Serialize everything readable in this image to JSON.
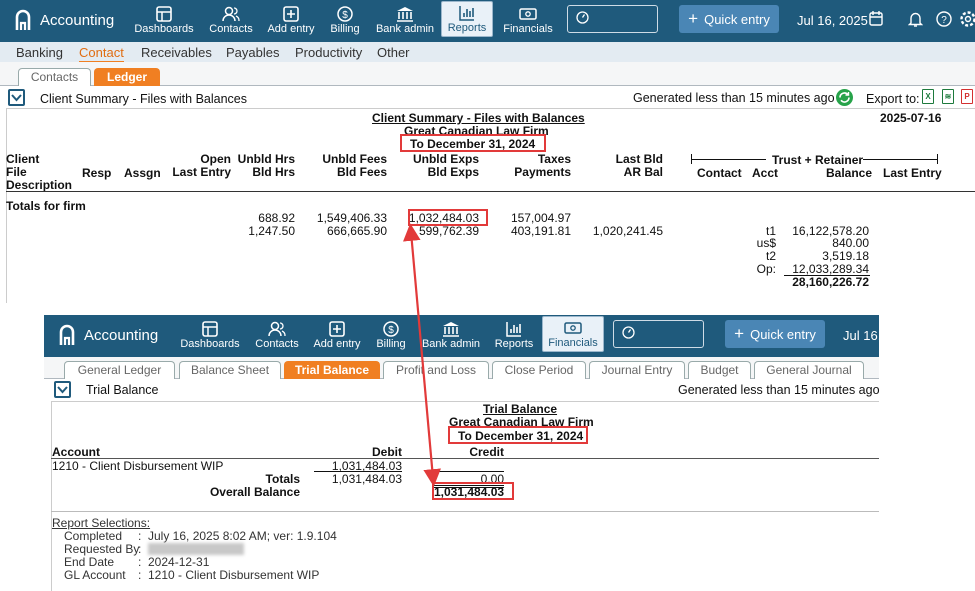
{
  "top": {
    "brand": "Accounting",
    "nav": [
      "Dashboards",
      "Contacts",
      "Add entry",
      "Billing",
      "Bank admin",
      "Reports",
      "Financials"
    ],
    "quick_entry": "Quick entry",
    "date": "Jul 16, 2025",
    "subnav": [
      "Banking",
      "Contact",
      "Receivables",
      "Payables",
      "Productivity",
      "Other"
    ],
    "tabs": [
      "Contacts",
      "Ledger"
    ],
    "panel_title": "Client Summary - Files with Balances",
    "generated": "Generated less than 15 minutes ago",
    "export_label": "Export to:",
    "report": {
      "title": "Client Summary - Files with Balances",
      "firm": "Great Canadian Law Firm",
      "period": "To December 31, 2024",
      "date": "2025-07-16",
      "headers": {
        "client": "Client",
        "file": "File",
        "description": "Description",
        "resp": "Resp",
        "assgn": "Assgn",
        "open": "Open",
        "last_entry": "Last Entry",
        "unbld_hrs": "Unbld Hrs",
        "bld_hrs": "Bld Hrs",
        "unbld_fees": "Unbld Fees",
        "bld_fees": "Bld Fees",
        "unbld_exps": "Unbld Exps",
        "bld_exps": "Bld Exps",
        "taxes": "Taxes",
        "payments": "Payments",
        "last_bld": "Last Bld",
        "ar_bal": "AR Bal",
        "trust_retainer": "Trust + Retainer",
        "contact": "Contact",
        "acct": "Acct",
        "balance": "Balance",
        "last_entry2": "Last Entry"
      },
      "totals_label": "Totals for firm",
      "row1": {
        "hrs": "688.92",
        "fees": "1,549,406.33",
        "exps": "1,032,484.03",
        "taxes": "157,004.97"
      },
      "row2": {
        "hrs": "1,247.50",
        "fees": "666,665.90",
        "exps": "599,762.39",
        "payments": "403,191.81",
        "ar": "1,020,241.45"
      },
      "trust": [
        {
          "acct": "t1",
          "bal": "16,122,578.20"
        },
        {
          "acct": "us$",
          "bal": "840.00"
        },
        {
          "acct": "t2",
          "bal": "3,519.18"
        },
        {
          "acct": "Op:",
          "bal": "12,033,289.34"
        }
      ],
      "trust_total": "28,160,226.72"
    }
  },
  "bottom": {
    "brand": "Accounting",
    "nav": [
      "Dashboards",
      "Contacts",
      "Add entry",
      "Billing",
      "Bank admin",
      "Reports",
      "Financials"
    ],
    "quick_entry": "Quick entry",
    "date": "Jul 16,",
    "tabs": [
      "General Ledger",
      "Balance Sheet",
      "Trial Balance",
      "Profit and Loss",
      "Close Period",
      "Journal Entry",
      "Budget",
      "General Journal"
    ],
    "panel_title": "Trial Balance",
    "generated": "Generated less than 15 minutes ago",
    "report": {
      "title": "Trial Balance",
      "firm": "Great Canadian Law Firm",
      "period": "To December 31, 2024",
      "account_header": "Account",
      "debit_header": "Debit",
      "credit_header": "Credit",
      "account": "1210 - Client Disbursement WIP",
      "account_debit": "1,031,484.03",
      "totals_label": "Totals",
      "totals_debit": "1,031,484.03",
      "totals_credit": "0.00",
      "overall_label": "Overall Balance",
      "overall_value": "1,031,484.03"
    },
    "selections": {
      "heading": "Report Selections:",
      "items": [
        {
          "label": "Completed",
          "value": "July 16, 2025 8:02 AM; ver: 1.9.104"
        },
        {
          "label": "Requested By",
          "value": ""
        },
        {
          "label": "End Date",
          "value": "2024-12-31"
        },
        {
          "label": "GL Account",
          "value": "1210 - Client Disbursement WIP"
        }
      ]
    }
  },
  "colors": {
    "nav": "#1f5a7c",
    "accent": "#f07f22",
    "highlight": "#e23a3a",
    "quick": "#4a86b5"
  }
}
